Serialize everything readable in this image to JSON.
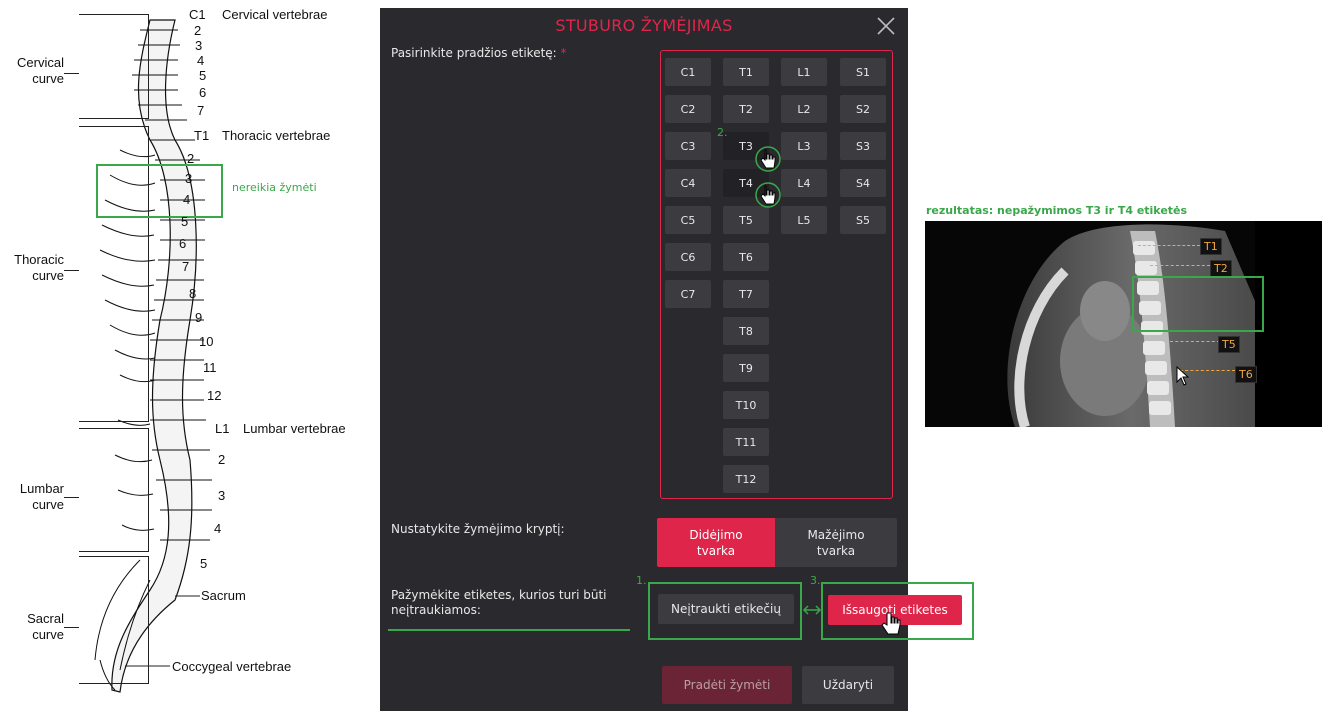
{
  "spine_diagram": {
    "section_labels": {
      "cervical_vertebrae": "Cervical vertebrae",
      "thoracic_vertebrae": "Thoracic vertebrae",
      "lumbar_vertebrae": "Lumbar vertebrae",
      "sacrum": "Sacrum",
      "coccygeal_vertebrae": "Coccygeal vertebrae"
    },
    "curves": {
      "cervical": "Cervical\ncurve",
      "thoracic": "Thoracic\ncurve",
      "lumbar": "Lumbar\ncurve",
      "sacral": "Sacral\ncurve"
    },
    "prefix_c1": "C1",
    "prefix_t1": "T1",
    "prefix_l1": "L1",
    "cervical_numbers": [
      "2",
      "3",
      "4",
      "5",
      "6",
      "7"
    ],
    "thoracic_numbers": [
      "2",
      "3",
      "4",
      "5",
      "6",
      "7",
      "8",
      "9",
      "10",
      "11",
      "12"
    ],
    "lumbar_numbers": [
      "2",
      "3",
      "4",
      "5"
    ],
    "annotation": "nereikia žymėti"
  },
  "dialog": {
    "title": "STUBURO ŽYMĖJIMAS",
    "start_label_prompt": "Pasirinkite pradžios etiketę:",
    "required_mark": "*",
    "columns": [
      [
        "C1",
        "C2",
        "C3",
        "C4",
        "C5",
        "C6",
        "C7"
      ],
      [
        "T1",
        "T2",
        "T3",
        "T4",
        "T5",
        "T6",
        "T7",
        "T8",
        "T9",
        "T10",
        "T11",
        "T12"
      ],
      [
        "L1",
        "L2",
        "L3",
        "L4",
        "L5"
      ],
      [
        "S1",
        "S2",
        "S3",
        "S4",
        "S5"
      ]
    ],
    "excluded": [
      "T3",
      "T4"
    ],
    "direction_prompt": "Nustatykite žymėjimo kryptį:",
    "direction_asc": "Didėjimo tvarka",
    "direction_desc": "Mažėjimo tvarka",
    "selected_direction": "Didėjimo tvarka",
    "exclude_prompt": "Pažymėkite etiketes, kurios turi būti neįtraukiamos:",
    "exclude_button": "Neįtraukti etikečių",
    "save_button": "Išsaugoti etiketes",
    "start_button": "Pradėti žymėti",
    "close_button": "Uždaryti",
    "step_markers": [
      "1.",
      "2.",
      "3."
    ]
  },
  "result": {
    "caption": "rezultatas: nepažymimos T3 ir T4  etiketės",
    "ct_labels": [
      "T1",
      "T2",
      "T5",
      "T6"
    ]
  },
  "colors": {
    "accent": "#e0254a",
    "annotation_green": "#3aa84a",
    "dialog_bg": "#2a2a2e",
    "button_bg": "#3b3b40",
    "ct_label": "#f2a640"
  }
}
